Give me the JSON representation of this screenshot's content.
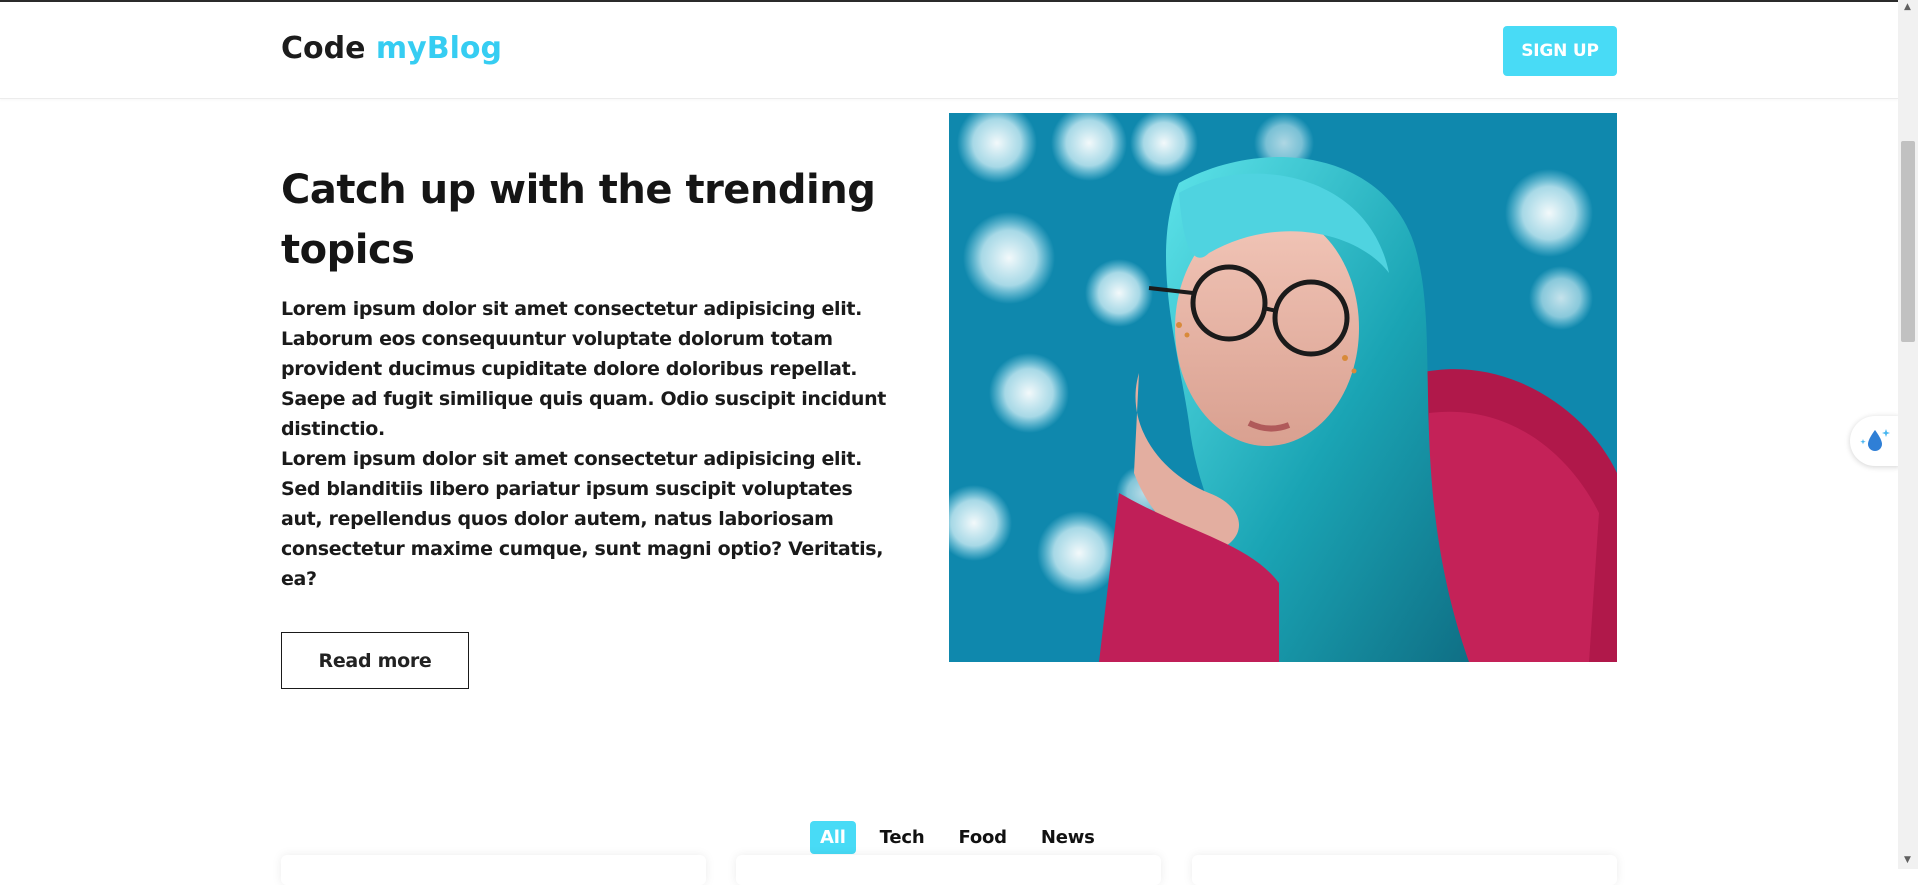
{
  "navbar": {
    "logo_part1": "Code ",
    "logo_part2": "myBlog",
    "signup_label": "SIGN UP"
  },
  "hero": {
    "title": "Catch up with the trending topics",
    "paragraph1": "Lorem ipsum dolor sit amet consectetur adipisicing elit. Laborum eos consequuntur voluptate dolorum totam provident ducimus cupiditate dolore doloribus repellat. Saepe ad fugit similique quis quam. Odio suscipit incidunt distinctio.",
    "paragraph2": "Lorem ipsum dolor sit amet consectetur adipisicing elit. Sed blanditiis libero pariatur ipsum suscipit voluptates aut, repellendus quos dolor autem, natus laboriosam consectetur maxime cumque, sunt magni optio? Veritatis, ea?",
    "read_more_label": "Read more"
  },
  "filters": {
    "tabs": [
      "All",
      "Tech",
      "Food",
      "News"
    ],
    "active": "All"
  },
  "colors": {
    "accent": "#48dbf6",
    "logo_accent": "#36cdf2",
    "text": "#111111"
  },
  "icons": {
    "floating_widget": "sparkle-drop-icon"
  }
}
